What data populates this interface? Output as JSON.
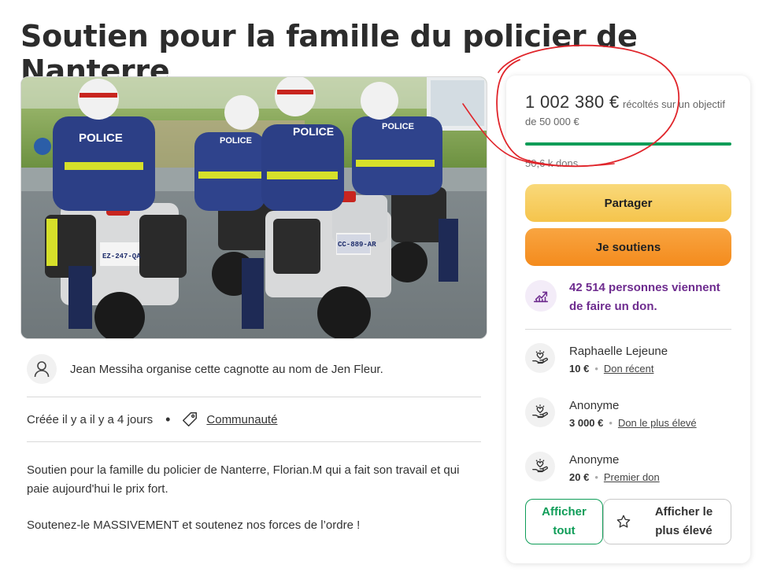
{
  "page": {
    "title": "Soutien pour la famille du policier de Nanterre"
  },
  "hero": {
    "police_label": "POLICE",
    "plates": [
      "EZ-247-QA",
      "CC-889-AR"
    ]
  },
  "organizer": {
    "text": "Jean Messiha organise cette cagnotte au nom de Jen Fleur."
  },
  "meta": {
    "created": "Créée il y a il y a 4 jours",
    "separator": "•",
    "category": "Communauté"
  },
  "description": {
    "p1": "Soutien pour la famille du policier de Nanterre, Florian.M qui a fait son travail et qui paie aujourd'hui le prix fort.",
    "p2": "Soutenez-le MASSIVEMENT et soutenez nos forces de l’ordre !"
  },
  "card": {
    "raised_amount": "1 002 380 €",
    "raised_rest": "récoltés sur un objectif de 50 000 €",
    "progress_fraction": 1.0,
    "donation_count": "50,6 k dons",
    "share_label": "Partager",
    "donate_label": "Je soutiens",
    "trend_text": "42 514 personnes viennent de faire un don.",
    "donors": [
      {
        "name": "Raphaelle Lejeune",
        "amount": "10 €",
        "label": "Don récent"
      },
      {
        "name": "Anonyme",
        "amount": "3 000 €",
        "label": "Don le plus élevé"
      },
      {
        "name": "Anonyme",
        "amount": "20 €",
        "label": "Premier don"
      }
    ],
    "donor_separator": "•",
    "show_all_label": "Afficher tout",
    "show_top_label": "Afficher le plus élevé"
  },
  "colors": {
    "accent_green": "#0f9d58",
    "share_yellow": "#f5c44c",
    "donate_orange": "#f48b1d",
    "trend_purple": "#6e2c8f",
    "annotation_red": "#e0252b"
  },
  "icons": {
    "organizer": "person-icon",
    "category": "tag-icon",
    "trend": "trending-up-icon",
    "donor": "heart-hand-icon",
    "top": "star-icon"
  }
}
